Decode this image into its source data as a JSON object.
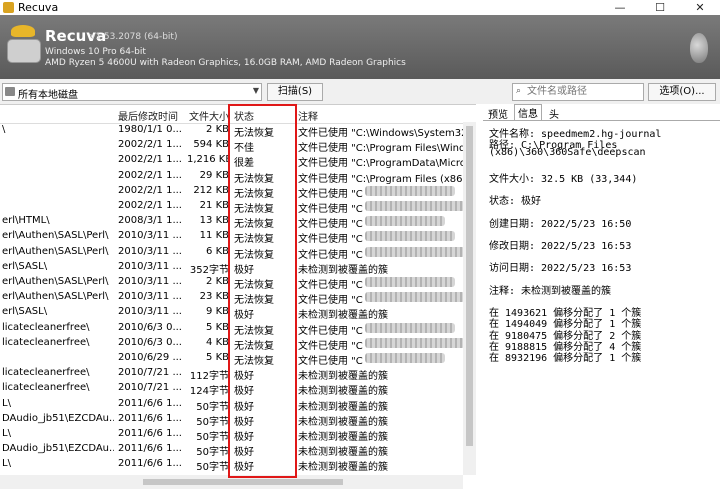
{
  "window": {
    "title": "Recuva",
    "min": "—",
    "max": "☐",
    "close": "✕"
  },
  "header": {
    "name": "Recuva",
    "version": "v1.53.2078 (64-bit)",
    "os": "Windows 10 Pro 64-bit",
    "hardware": "AMD Ryzen 5 4600U with Radeon Graphics, 16.0GB RAM, AMD Radeon Graphics"
  },
  "toolbar": {
    "drive_label": "所有本地磁盘",
    "scan_label": "扫描(S)",
    "search_placeholder": "文件名或路径",
    "options_label": "选项(O)..."
  },
  "table": {
    "headers": {
      "date": "最后修改时间",
      "size": "文件大小",
      "state": "状态",
      "note": "注释"
    },
    "rows": [
      {
        "path": "\\",
        "date": "1980/1/1 0...",
        "size": "2 KB",
        "state": "无法恢复",
        "note": "文件已使用 \"C:\\Windows\\System32\\FM"
      },
      {
        "path": "",
        "date": "2002/2/1 1...",
        "size": "594 KB",
        "state": "不佳",
        "note": "文件已使用 \"C:\\Program Files\\Window"
      },
      {
        "path": "",
        "date": "2002/2/1 1...",
        "size": "1,216 KB",
        "state": "很差",
        "note": "文件已使用 \"C:\\ProgramData\\Microsof"
      },
      {
        "path": "",
        "date": "2002/2/1 1...",
        "size": "29 KB",
        "state": "无法恢复",
        "note": "文件已使用 \"C:\\Program Files (x86)\\Mi"
      },
      {
        "path": "",
        "date": "2002/2/1 1...",
        "size": "212 KB",
        "state": "无法恢复",
        "note": "文件已使用 \"C"
      },
      {
        "path": "",
        "date": "2002/2/1 1...",
        "size": "21 KB",
        "state": "无法恢复",
        "note": "文件已使用 \"C"
      },
      {
        "path": "erl\\HTML\\",
        "date": "2008/3/1 1...",
        "size": "13 KB",
        "state": "无法恢复",
        "note": "文件已使用 \"C"
      },
      {
        "path": "erl\\Authen\\SASL\\Perl\\",
        "date": "2010/3/11 ...",
        "size": "11 KB",
        "state": "无法恢复",
        "note": "文件已使用 \"C"
      },
      {
        "path": "erl\\Authen\\SASL\\Perl\\",
        "date": "2010/3/11 ...",
        "size": "6 KB",
        "state": "无法恢复",
        "note": "文件已使用 \"C"
      },
      {
        "path": "erl\\SASL\\",
        "date": "2010/3/11 ...",
        "size": "352字节",
        "state": "极好",
        "note": "未检测到被覆盖的簇"
      },
      {
        "path": "erl\\Authen\\SASL\\Perl\\",
        "date": "2010/3/11 ...",
        "size": "2 KB",
        "state": "无法恢复",
        "note": "文件已使用 \"C"
      },
      {
        "path": "erl\\Authen\\SASL\\Perl\\",
        "date": "2010/3/11 ...",
        "size": "23 KB",
        "state": "无法恢复",
        "note": "文件已使用 \"C"
      },
      {
        "path": "erl\\SASL\\",
        "date": "2010/3/11 ...",
        "size": "9 KB",
        "state": "极好",
        "note": "未检测到被覆盖的簇"
      },
      {
        "path": "licatecleanerfree\\",
        "date": "2010/6/3 0...",
        "size": "5 KB",
        "state": "无法恢复",
        "note": "文件已使用 \"C"
      },
      {
        "path": "licatecleanerfree\\",
        "date": "2010/6/3 0...",
        "size": "4 KB",
        "state": "无法恢复",
        "note": "文件已使用 \"C"
      },
      {
        "path": "",
        "date": "2010/6/29 ...",
        "size": "5 KB",
        "state": "无法恢复",
        "note": "文件已使用 \"C"
      },
      {
        "path": "licatecleanerfree\\",
        "date": "2010/7/21 ...",
        "size": "112字节",
        "state": "极好",
        "note": "未检测到被覆盖的簇"
      },
      {
        "path": "licatecleanerfree\\",
        "date": "2010/7/21 ...",
        "size": "124字节",
        "state": "极好",
        "note": "未检测到被覆盖的簇"
      },
      {
        "path": "L\\",
        "date": "2011/6/6 1...",
        "size": "50字节",
        "state": "极好",
        "note": "未检测到被覆盖的簇"
      },
      {
        "path": "DAudio_jb51\\EZCDAu...",
        "date": "2011/6/6 1...",
        "size": "50字节",
        "state": "极好",
        "note": "未检测到被覆盖的簇"
      },
      {
        "path": "L\\",
        "date": "2011/6/6 1...",
        "size": "50字节",
        "state": "极好",
        "note": "未检测到被覆盖的簇"
      },
      {
        "path": "DAudio_jb51\\EZCDAu...",
        "date": "2011/6/6 1...",
        "size": "50字节",
        "state": "极好",
        "note": "未检测到被覆盖的簇"
      },
      {
        "path": "L\\",
        "date": "2011/6/6 1...",
        "size": "50字节",
        "state": "极好",
        "note": "未检测到被覆盖的簇"
      }
    ]
  },
  "panel": {
    "tabs": [
      "预览",
      "信息",
      "头"
    ],
    "lines": [
      "文件名称: speedmem2.hg-journal",
      "路径: C:\\Program Files",
      "(x86)\\360\\360Safe\\deepscan",
      "",
      "文件大小: 32.5 KB (33,344)",
      "",
      "状态: 极好",
      "",
      "创建日期: 2022/5/23 16:50",
      "",
      "修改日期: 2022/5/23 16:53",
      "",
      "访问日期: 2022/5/23 16:53",
      "",
      "注释: 未检测到被覆盖的簇",
      "",
      "在 1493621 偏移分配了 1 个簇",
      "在 1494049 偏移分配了 1 个簇",
      "在 9180475 偏移分配了 2 个簇",
      "在 9188815 偏移分配了 4 个簇",
      "在 8932196 偏移分配了 1 个簇"
    ]
  }
}
